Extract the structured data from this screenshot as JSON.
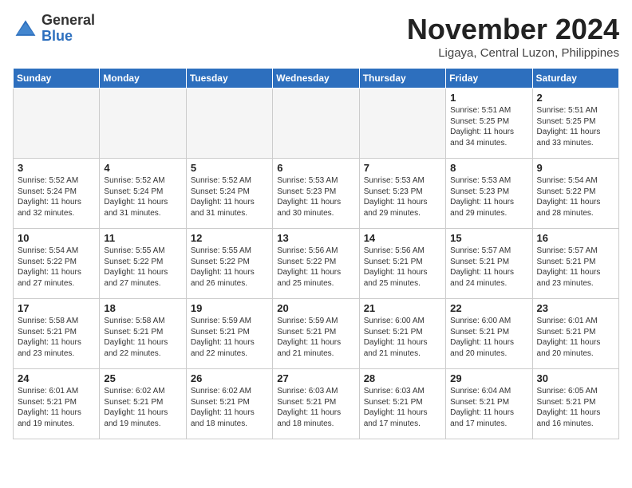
{
  "header": {
    "logo_general": "General",
    "logo_blue": "Blue",
    "month": "November 2024",
    "location": "Ligaya, Central Luzon, Philippines"
  },
  "days_of_week": [
    "Sunday",
    "Monday",
    "Tuesday",
    "Wednesday",
    "Thursday",
    "Friday",
    "Saturday"
  ],
  "weeks": [
    [
      {
        "day": "",
        "info": ""
      },
      {
        "day": "",
        "info": ""
      },
      {
        "day": "",
        "info": ""
      },
      {
        "day": "",
        "info": ""
      },
      {
        "day": "",
        "info": ""
      },
      {
        "day": "1",
        "info": "Sunrise: 5:51 AM\nSunset: 5:25 PM\nDaylight: 11 hours and 34 minutes."
      },
      {
        "day": "2",
        "info": "Sunrise: 5:51 AM\nSunset: 5:25 PM\nDaylight: 11 hours and 33 minutes."
      }
    ],
    [
      {
        "day": "3",
        "info": "Sunrise: 5:52 AM\nSunset: 5:24 PM\nDaylight: 11 hours and 32 minutes."
      },
      {
        "day": "4",
        "info": "Sunrise: 5:52 AM\nSunset: 5:24 PM\nDaylight: 11 hours and 31 minutes."
      },
      {
        "day": "5",
        "info": "Sunrise: 5:52 AM\nSunset: 5:24 PM\nDaylight: 11 hours and 31 minutes."
      },
      {
        "day": "6",
        "info": "Sunrise: 5:53 AM\nSunset: 5:23 PM\nDaylight: 11 hours and 30 minutes."
      },
      {
        "day": "7",
        "info": "Sunrise: 5:53 AM\nSunset: 5:23 PM\nDaylight: 11 hours and 29 minutes."
      },
      {
        "day": "8",
        "info": "Sunrise: 5:53 AM\nSunset: 5:23 PM\nDaylight: 11 hours and 29 minutes."
      },
      {
        "day": "9",
        "info": "Sunrise: 5:54 AM\nSunset: 5:22 PM\nDaylight: 11 hours and 28 minutes."
      }
    ],
    [
      {
        "day": "10",
        "info": "Sunrise: 5:54 AM\nSunset: 5:22 PM\nDaylight: 11 hours and 27 minutes."
      },
      {
        "day": "11",
        "info": "Sunrise: 5:55 AM\nSunset: 5:22 PM\nDaylight: 11 hours and 27 minutes."
      },
      {
        "day": "12",
        "info": "Sunrise: 5:55 AM\nSunset: 5:22 PM\nDaylight: 11 hours and 26 minutes."
      },
      {
        "day": "13",
        "info": "Sunrise: 5:56 AM\nSunset: 5:22 PM\nDaylight: 11 hours and 25 minutes."
      },
      {
        "day": "14",
        "info": "Sunrise: 5:56 AM\nSunset: 5:21 PM\nDaylight: 11 hours and 25 minutes."
      },
      {
        "day": "15",
        "info": "Sunrise: 5:57 AM\nSunset: 5:21 PM\nDaylight: 11 hours and 24 minutes."
      },
      {
        "day": "16",
        "info": "Sunrise: 5:57 AM\nSunset: 5:21 PM\nDaylight: 11 hours and 23 minutes."
      }
    ],
    [
      {
        "day": "17",
        "info": "Sunrise: 5:58 AM\nSunset: 5:21 PM\nDaylight: 11 hours and 23 minutes."
      },
      {
        "day": "18",
        "info": "Sunrise: 5:58 AM\nSunset: 5:21 PM\nDaylight: 11 hours and 22 minutes."
      },
      {
        "day": "19",
        "info": "Sunrise: 5:59 AM\nSunset: 5:21 PM\nDaylight: 11 hours and 22 minutes."
      },
      {
        "day": "20",
        "info": "Sunrise: 5:59 AM\nSunset: 5:21 PM\nDaylight: 11 hours and 21 minutes."
      },
      {
        "day": "21",
        "info": "Sunrise: 6:00 AM\nSunset: 5:21 PM\nDaylight: 11 hours and 21 minutes."
      },
      {
        "day": "22",
        "info": "Sunrise: 6:00 AM\nSunset: 5:21 PM\nDaylight: 11 hours and 20 minutes."
      },
      {
        "day": "23",
        "info": "Sunrise: 6:01 AM\nSunset: 5:21 PM\nDaylight: 11 hours and 20 minutes."
      }
    ],
    [
      {
        "day": "24",
        "info": "Sunrise: 6:01 AM\nSunset: 5:21 PM\nDaylight: 11 hours and 19 minutes."
      },
      {
        "day": "25",
        "info": "Sunrise: 6:02 AM\nSunset: 5:21 PM\nDaylight: 11 hours and 19 minutes."
      },
      {
        "day": "26",
        "info": "Sunrise: 6:02 AM\nSunset: 5:21 PM\nDaylight: 11 hours and 18 minutes."
      },
      {
        "day": "27",
        "info": "Sunrise: 6:03 AM\nSunset: 5:21 PM\nDaylight: 11 hours and 18 minutes."
      },
      {
        "day": "28",
        "info": "Sunrise: 6:03 AM\nSunset: 5:21 PM\nDaylight: 11 hours and 17 minutes."
      },
      {
        "day": "29",
        "info": "Sunrise: 6:04 AM\nSunset: 5:21 PM\nDaylight: 11 hours and 17 minutes."
      },
      {
        "day": "30",
        "info": "Sunrise: 6:05 AM\nSunset: 5:21 PM\nDaylight: 11 hours and 16 minutes."
      }
    ]
  ]
}
